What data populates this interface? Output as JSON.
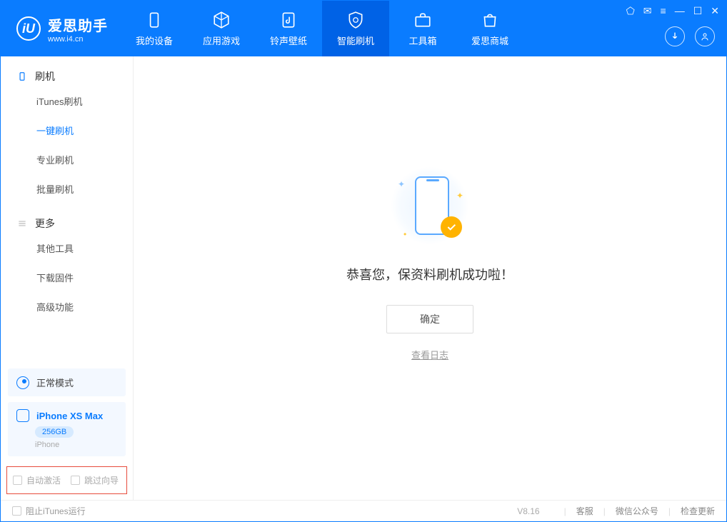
{
  "app": {
    "title": "爱思助手",
    "subtitle": "www.i4.cn"
  },
  "nav": {
    "items": [
      {
        "label": "我的设备"
      },
      {
        "label": "应用游戏"
      },
      {
        "label": "铃声壁纸"
      },
      {
        "label": "智能刷机",
        "active": true
      },
      {
        "label": "工具箱"
      },
      {
        "label": "爱思商城"
      }
    ]
  },
  "sidebar": {
    "section1": {
      "title": "刷机"
    },
    "items1": [
      {
        "label": "iTunes刷机"
      },
      {
        "label": "一键刷机",
        "active": true
      },
      {
        "label": "专业刷机"
      },
      {
        "label": "批量刷机"
      }
    ],
    "section2": {
      "title": "更多"
    },
    "items2": [
      {
        "label": "其他工具"
      },
      {
        "label": "下载固件"
      },
      {
        "label": "高级功能"
      }
    ],
    "status": {
      "label": "正常模式"
    },
    "device": {
      "name": "iPhone XS Max",
      "storage": "256GB",
      "type": "iPhone"
    },
    "bottom_opts": {
      "opt1": "自动激活",
      "opt2": "跳过向导"
    }
  },
  "main": {
    "success_msg": "恭喜您，保资料刷机成功啦！",
    "ok_btn": "确定",
    "log_link": "查看日志"
  },
  "footer": {
    "stop_itunes": "阻止iTunes运行",
    "version": "V8.16",
    "links": {
      "cs": "客服",
      "wx": "微信公众号",
      "update": "检查更新"
    }
  }
}
